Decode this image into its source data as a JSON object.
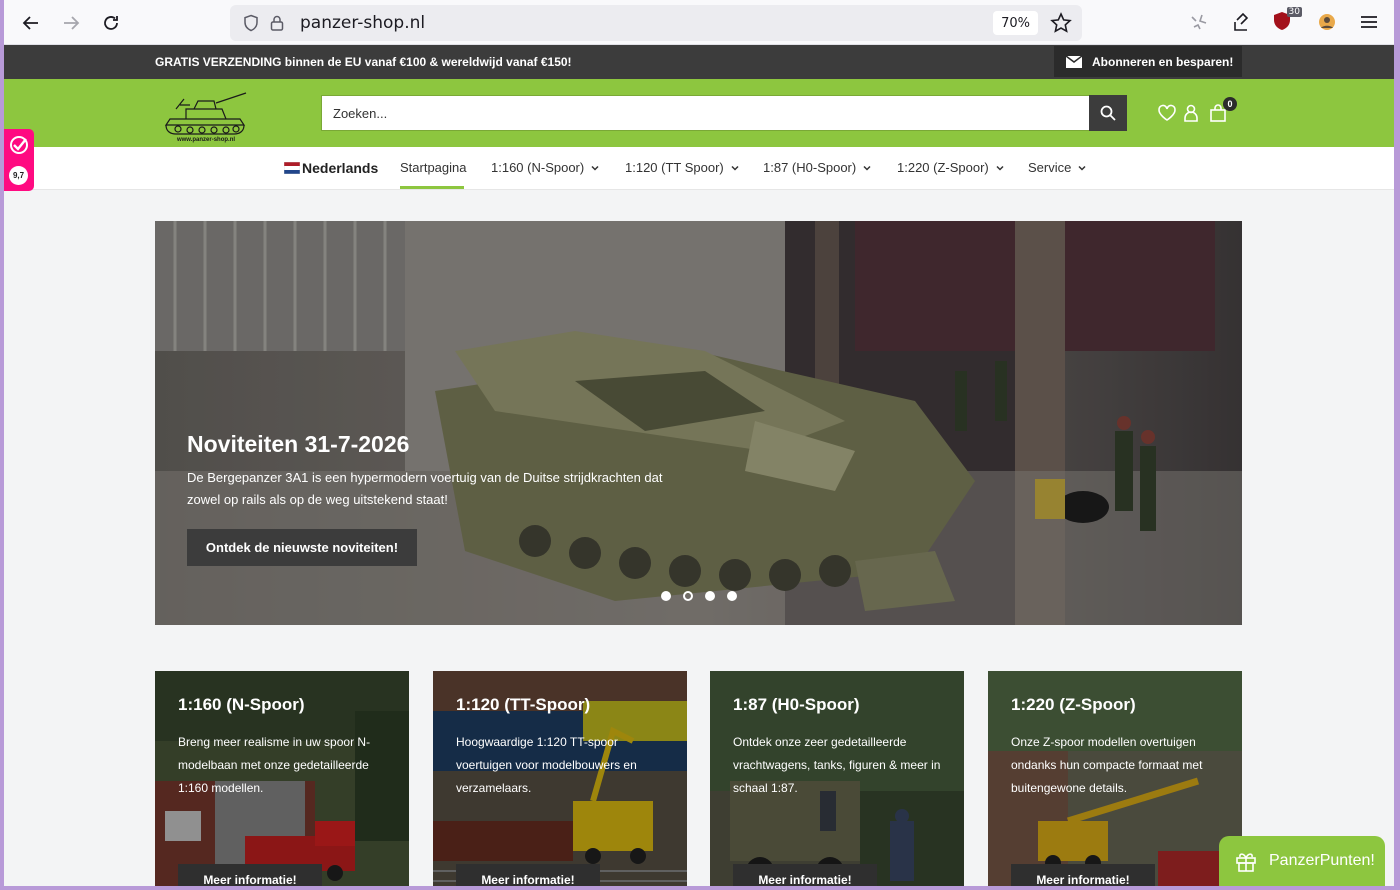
{
  "browser": {
    "url": "panzer-shop.nl",
    "zoom": "70%",
    "extension_badge": "30"
  },
  "topbar": {
    "promo": "GRATIS VERZENDING binnen de EU vanaf €100 & wereldwijd vanaf €150!",
    "subscribe_label": "Abonneren en besparen!"
  },
  "header": {
    "logo_text": "www.panzer-shop.nl",
    "search_placeholder": "Zoeken...",
    "cart_count": "0"
  },
  "nav": {
    "language": "Nederlands",
    "items": [
      {
        "label": "Startpagina"
      },
      {
        "label": "1:160 (N-Spoor)"
      },
      {
        "label": "1:120 (TT Spoor)"
      },
      {
        "label": "1:87 (H0-Spoor)"
      },
      {
        "label": "1:220 (Z-Spoor)"
      },
      {
        "label": "Service"
      }
    ]
  },
  "rating": {
    "score": "9,7"
  },
  "hero": {
    "title": "Noviteiten 31-7-2026",
    "text": "De Bergepanzer 3A1 is een hypermodern voertuig van de Duitse strijdkrachten dat zowel op rails als op de weg uitstekend staat!",
    "button": "Ontdek de nieuwste noviteiten!",
    "slide_count": 4,
    "active_slide": 2
  },
  "categories": [
    {
      "title": "1:160 (N-Spoor)",
      "desc": "Breng meer realisme in uw spoor N-modelbaan met onze gedetailleerde 1:160 modellen.",
      "button": "Meer informatie!"
    },
    {
      "title": "1:120 (TT-Spoor)",
      "desc": "Hoogwaardige 1:120 TT-spoor voertuigen voor modelbouwers en verzamelaars.",
      "button": "Meer informatie!"
    },
    {
      "title": "1:87 (H0-Spoor)",
      "desc": "Ontdek onze zeer gedetailleerde vrachtwagens, tanks, figuren & meer in schaal 1:87.",
      "button": "Meer informatie!"
    },
    {
      "title": "1:220 (Z-Spoor)",
      "desc": "Onze Z-spoor modellen overtuigen ondanks hun compacte formaat met buitengewone details.",
      "button": "Meer informatie!"
    }
  ],
  "rewards": {
    "label": "PanzerPunten!"
  },
  "colors": {
    "brand_green": "#8dc63f",
    "dark": "#3c3c3c",
    "rating_pink": "#ff0a81"
  }
}
